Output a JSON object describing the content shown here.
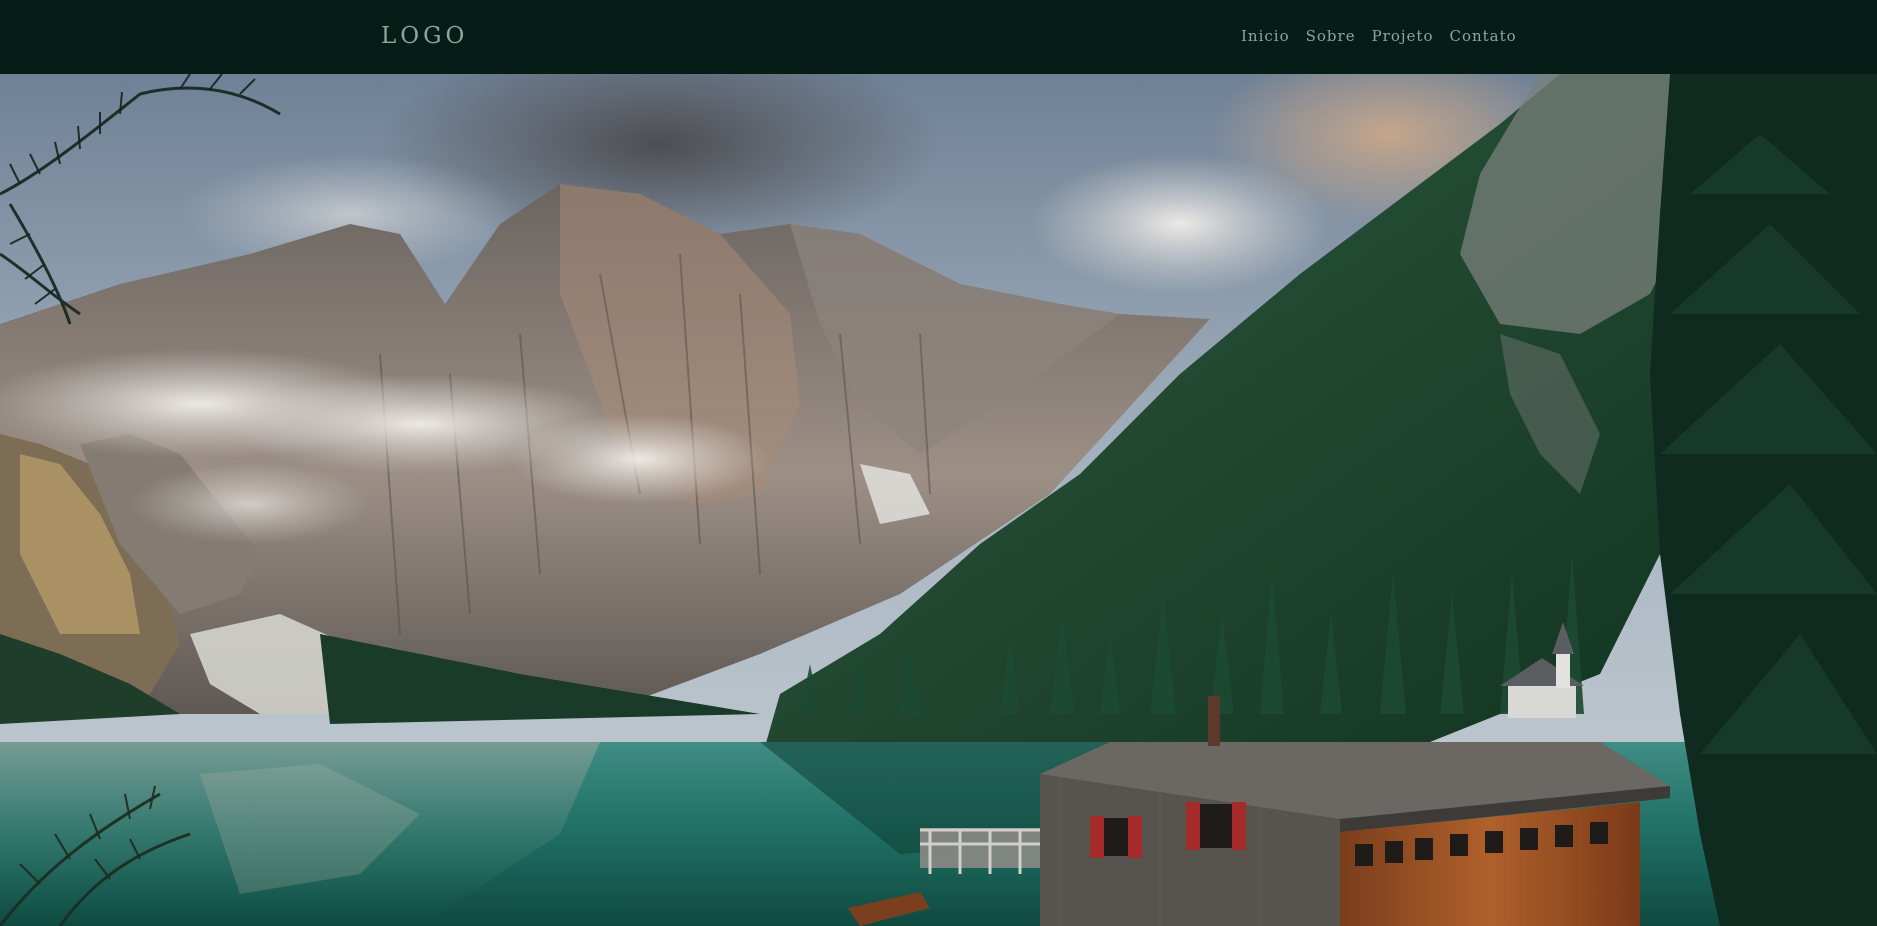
{
  "header": {
    "logo": "LOGO",
    "nav": [
      {
        "label": "Inicio"
      },
      {
        "label": "Sobre"
      },
      {
        "label": "Projeto"
      },
      {
        "label": "Contato"
      }
    ]
  },
  "hero": {
    "image": "mountain-lake-landscape-with-boathouse"
  },
  "colors": {
    "header_bg": "#061d17",
    "nav_text": "#8fa59b"
  }
}
